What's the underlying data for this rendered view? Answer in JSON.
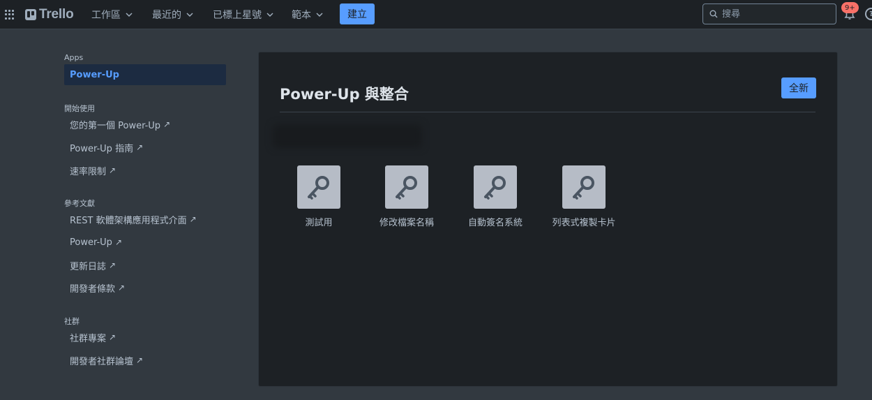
{
  "topbar": {
    "logo_text": "Trello",
    "nav": [
      {
        "label": "工作區"
      },
      {
        "label": "最近的"
      },
      {
        "label": "已標上星號"
      },
      {
        "label": "範本"
      }
    ],
    "create_label": "建立",
    "search_placeholder": "搜尋",
    "notification_count": "9+",
    "help_label": "?"
  },
  "sidebar": {
    "sections": [
      {
        "heading": "Apps",
        "links": [
          {
            "label": "Power-Up",
            "active": true
          }
        ]
      },
      {
        "heading": "開始使用",
        "links": [
          {
            "label": "您的第一個 Power-Up"
          },
          {
            "label": "Power-Up 指南"
          },
          {
            "label": "速率限制"
          }
        ]
      },
      {
        "heading": "參考文獻",
        "links": [
          {
            "label": "REST 軟體架構應用程式介面"
          },
          {
            "label": "Power-Up"
          },
          {
            "label": "更新日誌"
          },
          {
            "label": "開發者條款"
          }
        ]
      },
      {
        "heading": "社群",
        "links": [
          {
            "label": "社群專案"
          },
          {
            "label": "開發者社群論壇"
          }
        ]
      }
    ],
    "external_glyph": "↗"
  },
  "main": {
    "title": "Power-Up 與整合",
    "new_label": "全新",
    "apps": [
      {
        "name": "測試用",
        "icon": "key-icon"
      },
      {
        "name": "修改檔案名稱",
        "icon": "key-icon"
      },
      {
        "name": "自動簽名系統",
        "icon": "key-icon"
      },
      {
        "name": "列表式複製卡片",
        "icon": "key-icon"
      }
    ]
  },
  "colors": {
    "accent": "#579dff",
    "page_bg": "#323940",
    "panel_bg": "#1d2125",
    "badge": "#f87168"
  }
}
